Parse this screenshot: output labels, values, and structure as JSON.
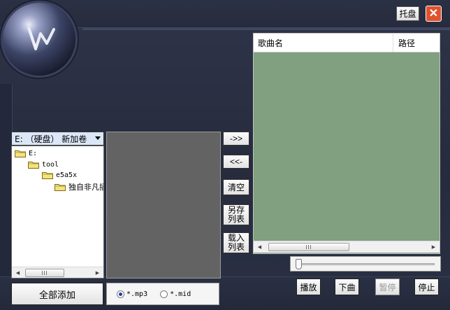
{
  "title_buttons": {
    "tray_label": "托盘",
    "close_label": "✕"
  },
  "explorer": {
    "drive_selected": "E: （硬盘） 新加卷",
    "tree": [
      {
        "label": "E:",
        "level": 0
      },
      {
        "label": "tool",
        "level": 1
      },
      {
        "label": "e5a5x",
        "level": 2
      },
      {
        "label": "独自非凡插",
        "level": 3
      }
    ]
  },
  "transfer_buttons": {
    "add_label": "->>",
    "remove_label": "<<-",
    "clear_label": "清空",
    "save_list_label": "另存列表",
    "load_list_label": "载入列表"
  },
  "playlist": {
    "columns": [
      "歌曲名",
      "路径"
    ]
  },
  "progress": {
    "value": 0
  },
  "bottom": {
    "add_all_label": "全部添加",
    "filters": [
      {
        "label": "*.mp3",
        "selected": true
      },
      {
        "label": "*.mid",
        "selected": false
      }
    ]
  },
  "controls": {
    "play_label": "播放",
    "next_label": "下曲",
    "pause_label": "暂停",
    "stop_label": "停止"
  },
  "colors": {
    "background": "#2a3043",
    "playlist_bg": "#80a080",
    "file_list_bg": "#636363",
    "close_red": "#e0522f"
  }
}
